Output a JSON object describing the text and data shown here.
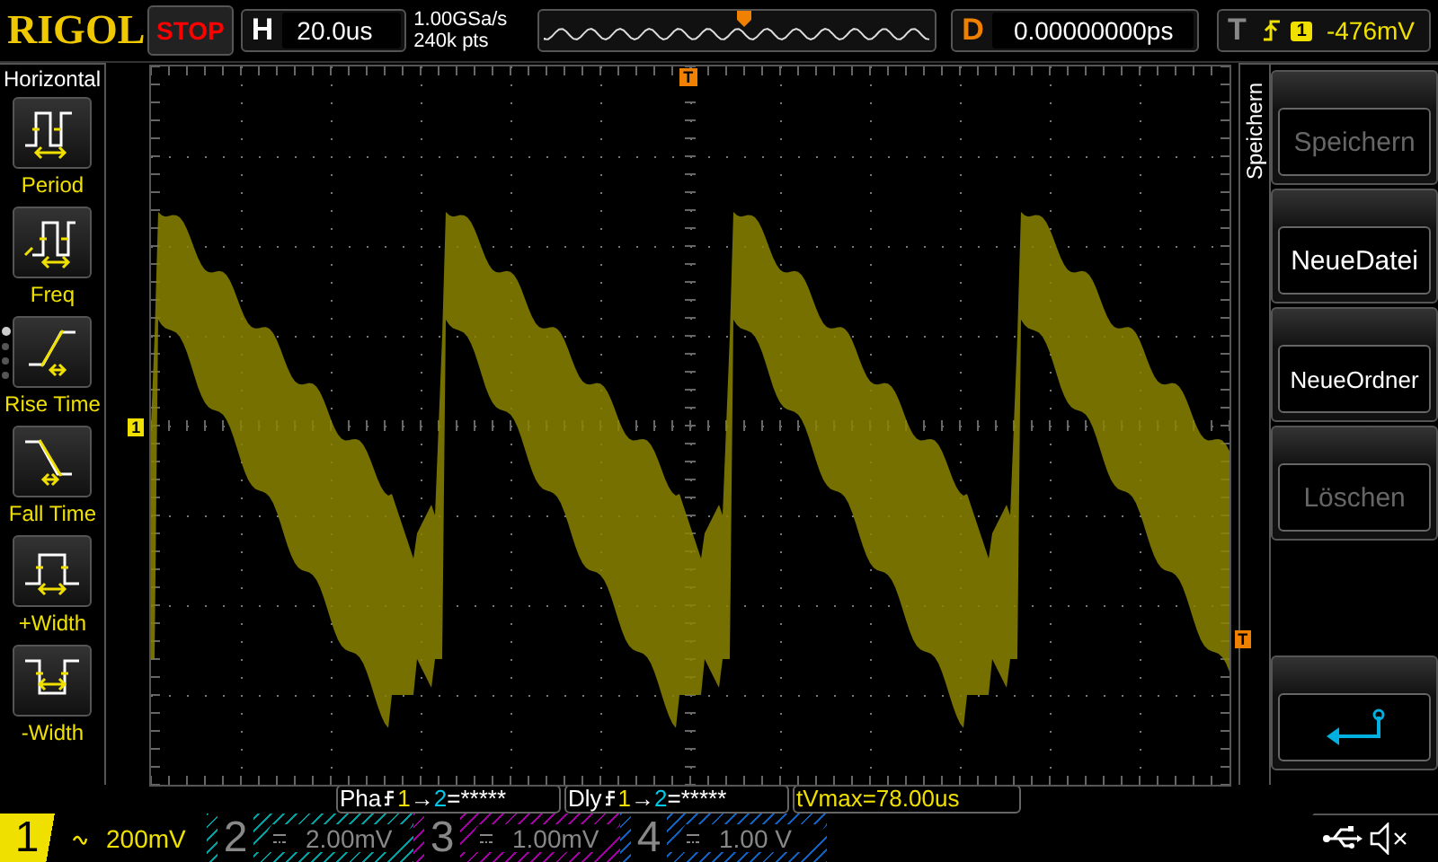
{
  "brand": "RIGOL",
  "run_state": "STOP",
  "timebase": {
    "label": "H",
    "value": "20.0us"
  },
  "acquisition": {
    "sample_rate": "1.00GSa/s",
    "memory_depth": "240k pts"
  },
  "delay": {
    "label": "D",
    "value": "0.00000000ps"
  },
  "trigger": {
    "label": "T",
    "source": "1",
    "level": "-476mV"
  },
  "horizontal_menu": {
    "title": "Horizontal",
    "items": [
      {
        "kind": "period",
        "label": "Period"
      },
      {
        "kind": "freq",
        "label": "Freq"
      },
      {
        "kind": "rise",
        "label": "Rise Time"
      },
      {
        "kind": "fall",
        "label": "Fall Time"
      },
      {
        "kind": "pwidth",
        "label": "+Width"
      },
      {
        "kind": "nwidth",
        "label": "-Width"
      }
    ],
    "pages": [
      {
        "selected": true
      },
      {
        "selected": false
      },
      {
        "selected": false
      },
      {
        "selected": false
      }
    ]
  },
  "screen": {
    "channel_marker": "1",
    "trigger_marker": "T",
    "trigger_level_marker": "T"
  },
  "save_menu": {
    "title": "Speichern",
    "buttons": [
      {
        "kind": "text",
        "label": "Speichern",
        "disabled": true
      },
      {
        "kind": "text",
        "label": "NeueDatei",
        "disabled": false
      },
      {
        "kind": "text",
        "label": "NeueOrdner",
        "disabled": false
      },
      {
        "kind": "text",
        "label": "Löschen",
        "disabled": true
      },
      {
        "kind": "back",
        "disabled": false
      }
    ]
  },
  "measurements": [
    {
      "kind": "pair",
      "name": "Pha",
      "source_a": "1",
      "arrow": "→",
      "source_b": "2",
      "value": "=*****"
    },
    {
      "kind": "pair",
      "name": "Dly",
      "source_a": "1",
      "arrow": "→",
      "source_b": "2",
      "value": "=*****"
    },
    {
      "kind": "single",
      "text": "tVmax=78.00us"
    }
  ],
  "channels": [
    {
      "number": "1",
      "kind": "ac",
      "scale": "200mV",
      "on": true,
      "color": "#f0e000"
    },
    {
      "number": "2",
      "kind": "dc",
      "scale": "2.00mV",
      "on": false,
      "color": "#00a0a0"
    },
    {
      "number": "3",
      "kind": "dc",
      "scale": "1.00mV",
      "on": false,
      "color": "#a000a0"
    },
    {
      "number": "4",
      "kind": "dc",
      "scale": "1.00 V",
      "on": false,
      "color": "#1060c0"
    }
  ]
}
